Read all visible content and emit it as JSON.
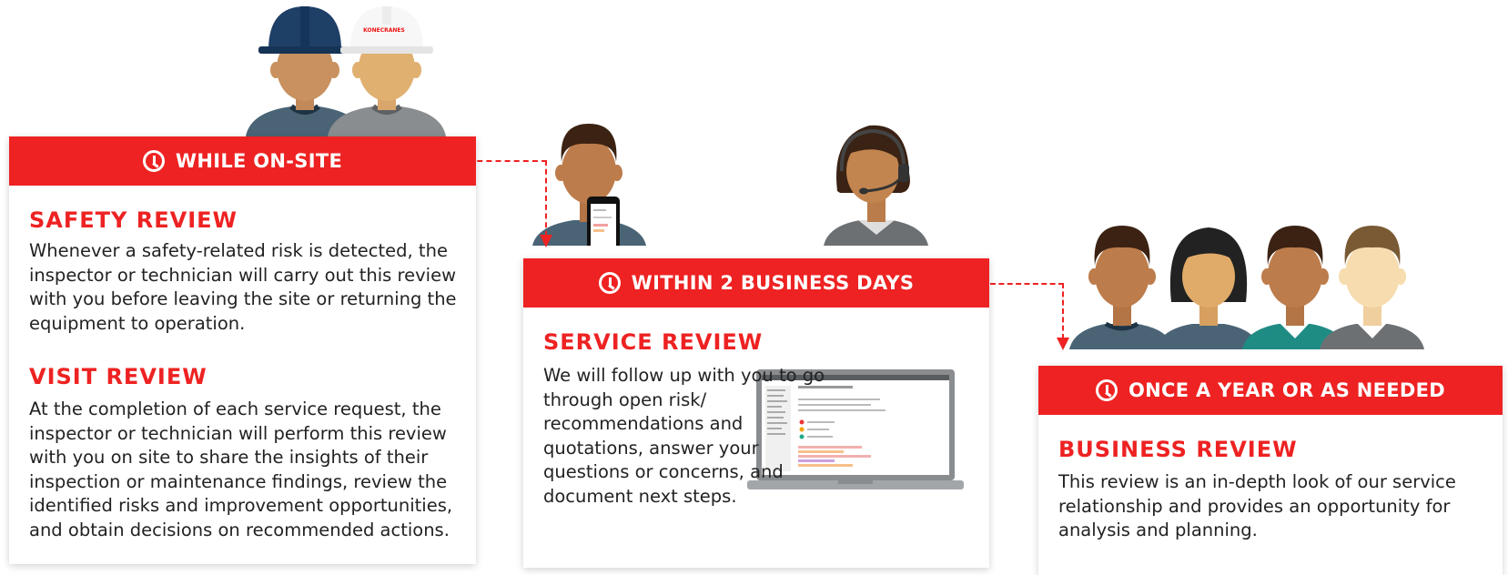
{
  "brand": {
    "logo_text": "KONECRANES",
    "accent": "#ee2222"
  },
  "stages": [
    {
      "banner": "WHILE ON-SITE",
      "sections": [
        {
          "title": "SAFETY REVIEW",
          "text": "Whenever a safety-related risk is detected, the inspector or technician will carry out this review with you before leaving the site or returning the equipment to operation."
        },
        {
          "title": "VISIT REVIEW",
          "text": "At the completion of each service request, the inspector or technician will perform this review with you on site to share the insights of their inspection or maintenance findings, review the identified risks and improvement opportunities, and obtain decisions on recommended actions."
        }
      ]
    },
    {
      "banner": "WITHIN 2 BUSINESS DAYS",
      "sections": [
        {
          "title": "SERVICE REVIEW",
          "text": "We will follow up with you to go through open risk/ recommendations and quotations, answer your questions or concerns, and document next steps."
        }
      ]
    },
    {
      "banner": "ONCE A YEAR OR AS NEEDED",
      "sections": [
        {
          "title": "BUSINESS REVIEW",
          "text": "This review is an in-depth look of our service relationship and provides an opportunity for analysis and planning."
        }
      ]
    }
  ]
}
